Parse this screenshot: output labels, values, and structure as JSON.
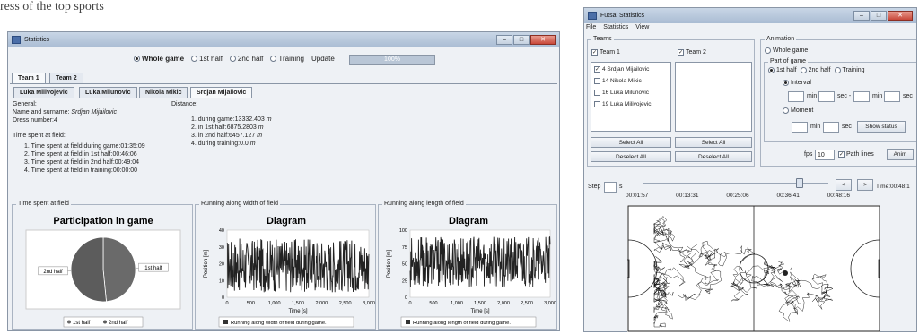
{
  "fragment_text": "ress of the top sports",
  "stats_window": {
    "title": "Statistics",
    "radios": [
      {
        "label": "Whole game",
        "selected": true
      },
      {
        "label": "1st half",
        "selected": false
      },
      {
        "label": "2nd half",
        "selected": false
      },
      {
        "label": "Training",
        "selected": false
      }
    ],
    "update_label": "Update",
    "progress_text": "100%",
    "progress_fraction": 1.0,
    "team_tabs": [
      "Team 1",
      "Team 2"
    ],
    "player_tabs": [
      "Luka Milivojevic",
      "Luka Milunovic",
      "Nikola Mikic",
      "Srdjan Mijailovic"
    ],
    "general_header": "General:",
    "name_label": "Name and surname:",
    "name_value": "Srdjan Mijailovic",
    "dress_label": "Dress number:",
    "dress_value": "4",
    "time_header": "Time spent at field:",
    "time_items": [
      "1.  Time spent at field during game:01:35:09",
      "2.  Time spent at field in 1st half:00:46:06",
      "3.  Time spent at field in 2nd half:00:49:04",
      "4.  Time spent at field in training:00:00:00"
    ],
    "distance_header": "Distance:",
    "distance_items": [
      {
        "label": "1.  during game:",
        "value": "13332.403",
        "unit": "m"
      },
      {
        "label": "2.  in 1st half:",
        "value": "6875.2803",
        "unit": "m"
      },
      {
        "label": "3.  in 2nd half:",
        "value": "6457.127",
        "unit": "m"
      },
      {
        "label": "4.  during training:",
        "value": "0.0",
        "unit": "m"
      }
    ],
    "panel_titles": [
      "Time spent at field",
      "Running along width of field",
      "Running along length of field"
    ]
  },
  "chart_data": [
    {
      "type": "pie",
      "title": "Participation in game",
      "labels": [
        "1st half",
        "2nd half"
      ],
      "values": [
        46.1,
        49.07
      ],
      "colors": [
        "#6a6a6a",
        "#5c5c5c"
      ],
      "legend": "bottom"
    },
    {
      "type": "line",
      "title": "Diagram",
      "xlabel": "Time [s]",
      "ylabel": "Position [m]",
      "xlim": [
        0,
        3000
      ],
      "ylim": [
        0,
        40
      ],
      "xticks": [
        "0",
        "500",
        "1,000",
        "1,500",
        "2,000",
        "2,500",
        "3,000"
      ],
      "yticks": [
        "0",
        "10",
        "20",
        "30",
        "40"
      ],
      "series": [
        {
          "name": "Running along width of field during game.",
          "band": [
            3,
            35
          ]
        }
      ],
      "legend": "bottom"
    },
    {
      "type": "line",
      "title": "Diagram",
      "xlabel": "Time [s]",
      "ylabel": "Position [m]",
      "xlim": [
        0,
        3000
      ],
      "ylim": [
        0,
        100
      ],
      "xticks": [
        "0",
        "500",
        "1,000",
        "1,500",
        "2,000",
        "2,500",
        "3,000"
      ],
      "yticks": [
        "0",
        "25",
        "50",
        "75",
        "100"
      ],
      "series": [
        {
          "name": "Running along length of field during game.",
          "band": [
            15,
            90
          ]
        }
      ],
      "legend": "bottom"
    }
  ],
  "futsal_window": {
    "title": "Futsal Statistics",
    "menu": [
      "File",
      "Statistics",
      "View"
    ],
    "teams_group": "Teams",
    "team1_label": "Team 1",
    "team2_label": "Team 2",
    "players": [
      {
        "label": "4 Srdjan Mijailovic",
        "checked": true
      },
      {
        "label": "14 Nikola Mikic",
        "checked": false
      },
      {
        "label": "16 Luka Milunovic",
        "checked": false
      },
      {
        "label": "19 Luka Milivojevic",
        "checked": false
      }
    ],
    "select_all": "Select All",
    "deselect_all": "Deselect All",
    "animation_group": "Animation",
    "whole_game": "Whole game",
    "part_group": "Part of game",
    "part_radios": [
      "1st half",
      "2nd half",
      "Training"
    ],
    "interval": "Interval",
    "min": "min",
    "sec": "sec",
    "sec_dash": "sec -",
    "moment": "Moment",
    "show_status": "Show status",
    "fps_label": "fps",
    "fps_value": "10",
    "path_lines": "Path lines",
    "anim": "Anim",
    "step_label": "Step",
    "step_unit": "s",
    "slider_fraction": 0.86,
    "slider_ticks": [
      "00:01:57",
      "00:13:31",
      "00:25:06",
      "00:36:41",
      "00:48:16"
    ],
    "prev": "<",
    "next": ">",
    "time_readout": "Time:00:48:1",
    "marker_label": "4"
  }
}
